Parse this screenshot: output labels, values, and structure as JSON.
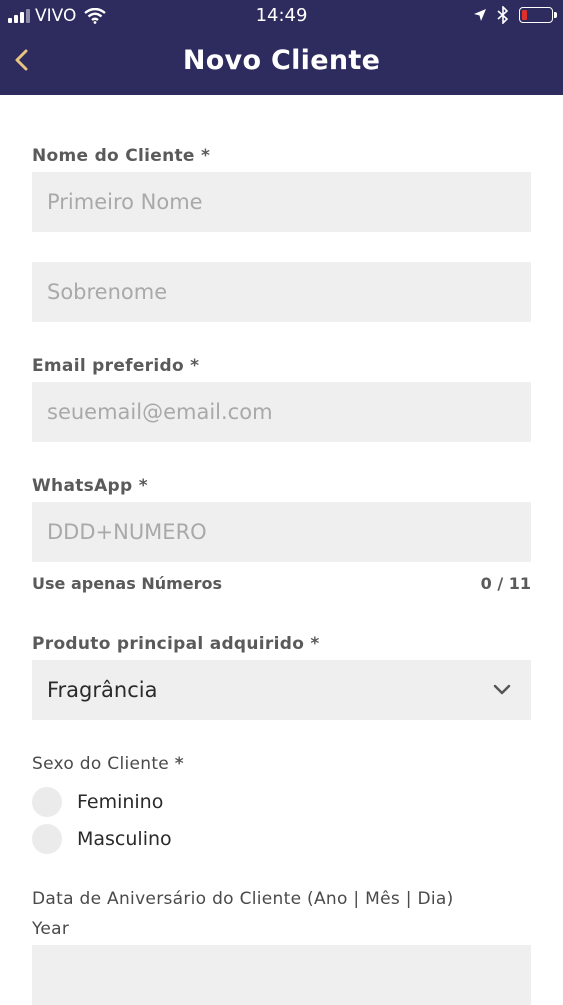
{
  "status_bar": {
    "carrier": "VIVO",
    "time": "14:49"
  },
  "header": {
    "title": "Novo Cliente"
  },
  "form": {
    "name": {
      "label": "Nome do Cliente",
      "required": "*",
      "first_placeholder": "Primeiro Nome",
      "last_placeholder": "Sobrenome"
    },
    "email": {
      "label": "Email preferido",
      "required": "*",
      "placeholder": "seuemail@email.com"
    },
    "whatsapp": {
      "label": "WhatsApp",
      "required": "*",
      "placeholder": "DDD+NUMERO",
      "hint": "Use apenas Números",
      "counter": "0 / 11"
    },
    "product": {
      "label": "Produto principal adquirido",
      "required": "*",
      "value": "Fragrância"
    },
    "sex": {
      "label": "Sexo do Cliente",
      "required": "*",
      "options": [
        "Feminino",
        "Masculino"
      ]
    },
    "birthday": {
      "label": "Data de Aniversário do Cliente (Ano | Mês | Dia)",
      "year_label": "Year"
    }
  },
  "colors": {
    "header_bg": "#2e2b5e",
    "field_bg": "#efefef",
    "battery_low": "#e0302b"
  },
  "icons": [
    "signal-icon",
    "wifi-icon",
    "location-arrow-icon",
    "bluetooth-icon",
    "battery-icon",
    "back-chevron-icon",
    "chevron-down-icon"
  ]
}
